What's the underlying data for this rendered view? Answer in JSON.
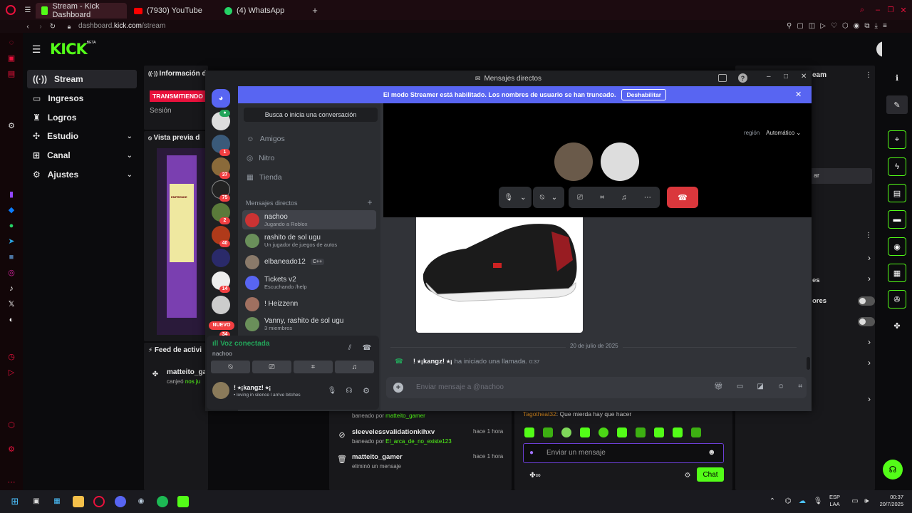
{
  "browser": {
    "tabs": [
      {
        "label": "Stream - Kick Dashboard"
      },
      {
        "label": "(7930) YouTube"
      },
      {
        "label": "(4) WhatsApp"
      }
    ],
    "url_domain": "dashboard.kick.com",
    "url_prefix": "dashboard.",
    "url_host": "kick.com",
    "url_path": "/stream"
  },
  "kick": {
    "logo": "KICK",
    "logo_sup": "BETA",
    "nav": [
      {
        "label": "Stream"
      },
      {
        "label": "Ingresos"
      },
      {
        "label": "Logros"
      },
      {
        "label": "Estudio"
      },
      {
        "label": "Canal"
      },
      {
        "label": "Ajustes"
      }
    ],
    "info_title": "Información d",
    "live_badge": "TRANSMITIENDO",
    "session_label": "Sesión",
    "preview_title": "Vista previa d",
    "feed_title": "Feed de activi",
    "feed_user": "matteito_ga",
    "feed_line": "canjeó",
    "feed_suffix": "nos ju",
    "right_panel_title": "eam",
    "right_btn": "ar",
    "row_es": "es",
    "row_ores": "ores",
    "preview_text": "EMPRENDE"
  },
  "modlog": [
    {
      "line1_prefix": "baneado por",
      "line1_user": "matteito_gamer"
    },
    {
      "name": "sleevelessvalidationkihxv",
      "time": "hace 1 hora",
      "action": "baneado por",
      "by": "El_arca_de_no_existe123"
    },
    {
      "name": "matteito_gamer",
      "time": "hace 1 hora",
      "action": "eliminó un mensaje"
    }
  ],
  "chat": {
    "last_msg_user": "Tagotheat32",
    "last_msg": ": Que mierda hay que hacer",
    "input_placeholder": "Enviar un mensaje",
    "send_label": "Chat"
  },
  "discord": {
    "window_title": "Mensajes directos",
    "streamer_notice": "El modo Streamer está habilitado. Los nombres de usuario se han truncado.",
    "streamer_disable": "Deshabilitar",
    "search_placeholder": "Busca o inicia una conversación",
    "menu": [
      {
        "label": "Amigos"
      },
      {
        "label": "Nitro"
      },
      {
        "label": "Tienda"
      }
    ],
    "dm_header": "Mensajes directos",
    "dms": [
      {
        "name": "nachoo",
        "status": "Jugando a Roblox",
        "color": "#c33"
      },
      {
        "name": "rashito de sol ugu",
        "status": "Un jugador de juegos de autos",
        "color": "#6a8f5a"
      },
      {
        "name": "elbaneado12",
        "status": "",
        "tag": "C++",
        "color": "#8a7a6a"
      },
      {
        "name": "Tickets v2",
        "status": "Escuchando /help",
        "color": "#5865f2"
      },
      {
        "name": "! Heizzenn",
        "status": "",
        "color": "#a07060"
      },
      {
        "name": "Vanny, rashito de sol ugu",
        "status": "3 miembros",
        "color": "#6a8f5a"
      }
    ],
    "guild_badges": [
      "1",
      "37",
      "75",
      "2",
      "40",
      "14",
      "34"
    ],
    "new_badge": "NUEVO",
    "voice_status": "Voz conectada",
    "voice_user": "nachoo",
    "self_name": "! ⭑¡kangz! ⭑¡",
    "self_status": "• loving in silence l arrive bitches",
    "region_label": "región",
    "region_value": "Automático",
    "date_divider": "20 de julio de 2025",
    "call_user": "! ⭑¡kangz! ⭑¡",
    "call_text": "ha iniciado una llamada.",
    "call_time": "0:37",
    "msg_placeholder": "Enviar mensaje a @nachoo"
  },
  "taskbar": {
    "lang": "ESP",
    "lang2": "LAA",
    "time": "00:37",
    "date": "20/7/2025"
  },
  "colors": {
    "kick_green": "#53fc18",
    "discord_blurple": "#5865f2",
    "live_red": "#e9113c",
    "hangup": "#da373c"
  }
}
